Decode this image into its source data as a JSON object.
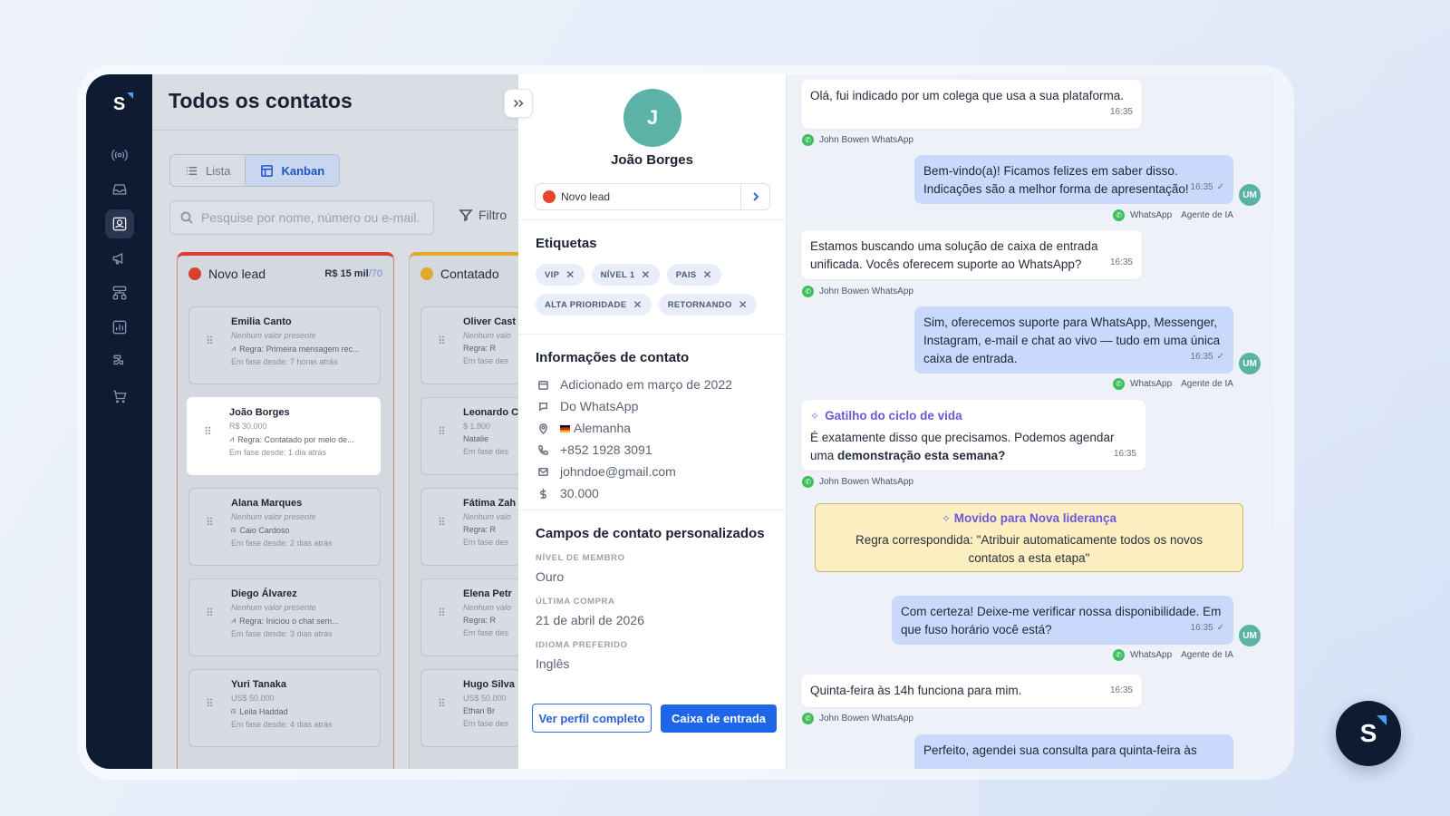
{
  "sidebar": {
    "logo": "S",
    "icons": [
      "broadcast-icon",
      "inbox-icon",
      "contacts-icon",
      "megaphone-icon",
      "workflow-icon",
      "reports-icon",
      "integrations-icon",
      "cart-icon"
    ]
  },
  "contacts": {
    "title": "Todos os contatos",
    "views": {
      "list": "Lista",
      "kanban": "Kanban"
    },
    "search_placeholder": "Pesquise por nome, número ou e-mail.",
    "filter": "Filtro",
    "columns": [
      {
        "name": "Novo lead",
        "amount": "R$ 15 mil",
        "amount_extra": "/70",
        "color": "#d9412f",
        "cards": [
          {
            "name": "Emilia Canto",
            "value": "Nenhum valor presente",
            "rule": "Regra: Primeira mensagem rec...",
            "since": "Em fase desde: 7 horas atrás"
          },
          {
            "name": "João Borges",
            "value": "R$ 30.000",
            "rule": "Regra: Contatado por meio de...",
            "since": "Em fase desde: 1 dia atrás"
          },
          {
            "name": "Alana Marques",
            "value": "Nenhum valor presente",
            "rule": "Caio Cardoso",
            "since": "Em fase desde: 2 dias atrás"
          },
          {
            "name": "Diego Álvarez",
            "value": "Nenhum valor presente",
            "rule": "Regra: Iniciou o chat sem...",
            "since": "Em fase desde: 3 dias atrás"
          },
          {
            "name": "Yuri Tanaka",
            "value": "US$ 50.000",
            "rule": "Leila Haddad",
            "since": "Em fase desde: 4 dias atrás"
          }
        ]
      },
      {
        "name": "Contatado",
        "color": "#e0a92c",
        "cards": [
          {
            "name": "Oliver Cast",
            "value": "Nenhum valo",
            "rule": "Regra: R",
            "since": "Em fase des"
          },
          {
            "name": "Leonardo C",
            "value": "$ 1.800",
            "rule": "Natalie",
            "since": "Em fase des"
          },
          {
            "name": "Fátima Zah",
            "value": "Nenhum valo",
            "rule": "Regra: R",
            "since": "Em fase des"
          },
          {
            "name": "Elena Petr",
            "value": "Nenhum valo",
            "rule": "Regra: R",
            "since": "Em fase des"
          },
          {
            "name": "Hugo Silva",
            "value": "US$ 50.000",
            "rule": "Ethan Br",
            "since": "Em fase des"
          }
        ]
      }
    ]
  },
  "detail": {
    "initial": "J",
    "name": "João Borges",
    "stage": "Novo lead",
    "tags_title": "Etiquetas",
    "tags": [
      "VIP",
      "NÍVEL 1",
      "PAIS",
      "ALTA PRIORIDADE",
      "RETORNANDO"
    ],
    "info_title": "Informações de contato",
    "info": {
      "added": "Adicionado em março de 2022",
      "source": "Do WhatsApp",
      "country": "Alemanha",
      "phone": "+852 1928 3091",
      "email": "johndoe@gmail.com",
      "value": "30.000"
    },
    "custom_title": "Campos de contato personalizados",
    "fields": [
      {
        "label": "NÍVEL DE MEMBRO",
        "value": "Ouro"
      },
      {
        "label": "ÚLTIMA COMPRA",
        "value": "21 de abril de 2026"
      },
      {
        "label": "IDIOMA PREFERIDO",
        "value": "Inglês"
      }
    ],
    "btn_profile": "Ver perfil completo",
    "btn_inbox": "Caixa de entrada"
  },
  "chat": {
    "messages": [
      {
        "text": "Olá, fui indicado por um colega que usa a sua plataforma.",
        "time": "16:35",
        "meta": "John Bowen WhatsApp"
      },
      {
        "text": "Bem-vindo(a)! Ficamos felizes em saber disso. Indicações são a melhor forma de apresentação!",
        "time": "16:35",
        "meta1": "WhatsApp",
        "meta2": "Agente de IA",
        "avatar": "UM"
      },
      {
        "text": "Estamos buscando uma solução de caixa de entrada unificada. Vocês oferecem suporte ao WhatsApp?",
        "time": "16:35",
        "meta": "John Bowen WhatsApp"
      },
      {
        "text": "Sim, oferecemos suporte para WhatsApp, Messenger, Instagram, e-mail e chat ao vivo — tudo em uma única caixa de entrada.",
        "time": "16:35",
        "meta1": "WhatsApp",
        "meta2": "Agente de IA",
        "avatar": "UM"
      },
      {
        "trigger": "Gatilho do ciclo de vida",
        "text_a": "É exatamente disso que precisamos. Podemos agendar uma ",
        "text_b": "demonstração esta semana?",
        "time": "16:35",
        "meta": "John Bowen WhatsApp"
      },
      {
        "text": "Com certeza! Deixe-me verificar nossa disponibilidade. Em que fuso horário você está?",
        "time": "16:35",
        "meta1": "WhatsApp",
        "meta2": "Agente de IA",
        "avatar": "UM"
      },
      {
        "text": "Quinta-feira às 14h funciona para mim.",
        "time": "16:35",
        "meta": "John Bowen WhatsApp"
      },
      {
        "text": "Perfeito, agendei sua consulta para quinta-feira às"
      }
    ],
    "moved": {
      "title": "Movido para Nova liderança",
      "text": "Regra correspondida: \"Atribuir automaticamente todos os novos contatos a esta etapa\""
    }
  },
  "fab": {
    "label": "S"
  },
  "colors": {
    "accent": "#1e66e8",
    "sidebar": "#0f1a33",
    "avatar": "#5bb3a7",
    "stage_dot": "#e9452f"
  }
}
